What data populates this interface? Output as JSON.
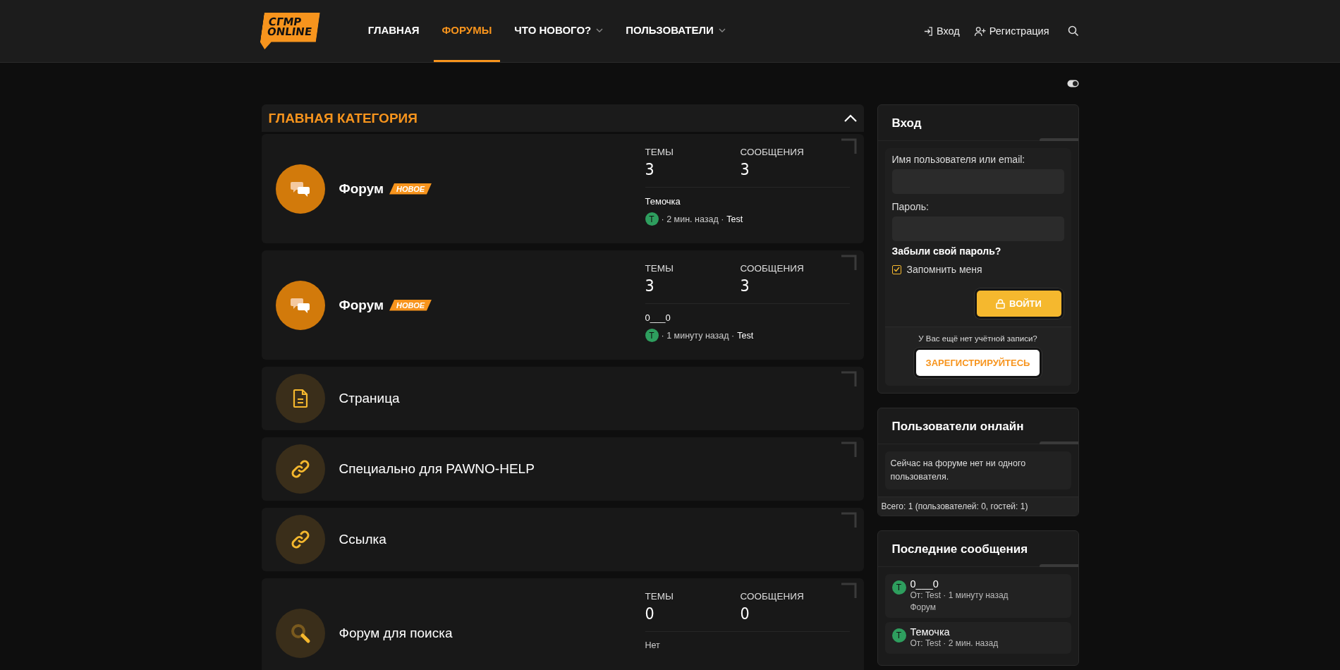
{
  "header": {
    "logo": [
      "СГМР",
      "ONLINE"
    ],
    "nav": [
      {
        "label": "ГЛАВНАЯ",
        "selected": false,
        "dropdown": false
      },
      {
        "label": "ФОРУМЫ",
        "selected": true,
        "dropdown": false
      },
      {
        "label": "ЧТО НОВОГО?",
        "selected": false,
        "dropdown": true
      },
      {
        "label": "ПОЛЬЗОВАТЕЛИ",
        "selected": false,
        "dropdown": true
      }
    ],
    "login": "Вход",
    "register": "Регистрация"
  },
  "category": {
    "title": "ГЛАВНАЯ КАТЕГОРИЯ",
    "expanded": true,
    "nodes": [
      {
        "kind": "forum",
        "unread": true,
        "title": "Форум",
        "badge": "НОВОЕ",
        "stats": [
          {
            "label": "ТЕМЫ",
            "value": "3"
          },
          {
            "label": "СООБЩЕНИЯ",
            "value": "3"
          }
        ],
        "last": {
          "title": "Темочка",
          "avatar": "T",
          "meta": "· 2 мин. назад ·",
          "user": "Test"
        }
      },
      {
        "kind": "forum",
        "unread": true,
        "title": "Форум",
        "badge": "НОВОЕ",
        "stats": [
          {
            "label": "ТЕМЫ",
            "value": "3"
          },
          {
            "label": "СООБЩЕНИЯ",
            "value": "3"
          }
        ],
        "last": {
          "title": "0___0",
          "avatar": "T",
          "meta": "· 1 минуту назад ·",
          "user": "Test"
        }
      },
      {
        "kind": "page",
        "unread": false,
        "title": "Страница"
      },
      {
        "kind": "link",
        "unread": false,
        "title": "Специально для PAWNO-HELP"
      },
      {
        "kind": "link",
        "unread": false,
        "title": "Ссылка"
      },
      {
        "kind": "search",
        "unread": false,
        "title": "Форум для поиска",
        "stats": [
          {
            "label": "ТЕМЫ",
            "value": "0"
          },
          {
            "label": "СООБЩЕНИЯ",
            "value": "0"
          }
        ],
        "none": "Нет"
      }
    ]
  },
  "login_block": {
    "title": "Вход",
    "username_label": "Имя пользователя или email:",
    "password_label": "Пароль:",
    "forgot": "Забыли свой пароль?",
    "remember": {
      "label": "Запомнить меня",
      "checked": true
    },
    "submit": "ВОЙТИ",
    "no_account": "У Вас ещё нет учётной записи?",
    "register": "ЗАРЕГИСТРИРУЙТЕСЬ"
  },
  "online_block": {
    "title": "Пользователи онлайн",
    "message": "Сейчас на форуме нет ни одного пользователя.",
    "footer": "Всего: 1 (пользователей: 0, гостей: 1)"
  },
  "recent_block": {
    "title": "Последние сообщения",
    "posts": [
      {
        "avatar": "T",
        "title": "0___0",
        "meta": "От: Test · 1 минуту назад",
        "forum": "Форум"
      },
      {
        "avatar": "T",
        "title": "Темочка",
        "meta": "От: Test · 2 мин. назад"
      }
    ]
  }
}
